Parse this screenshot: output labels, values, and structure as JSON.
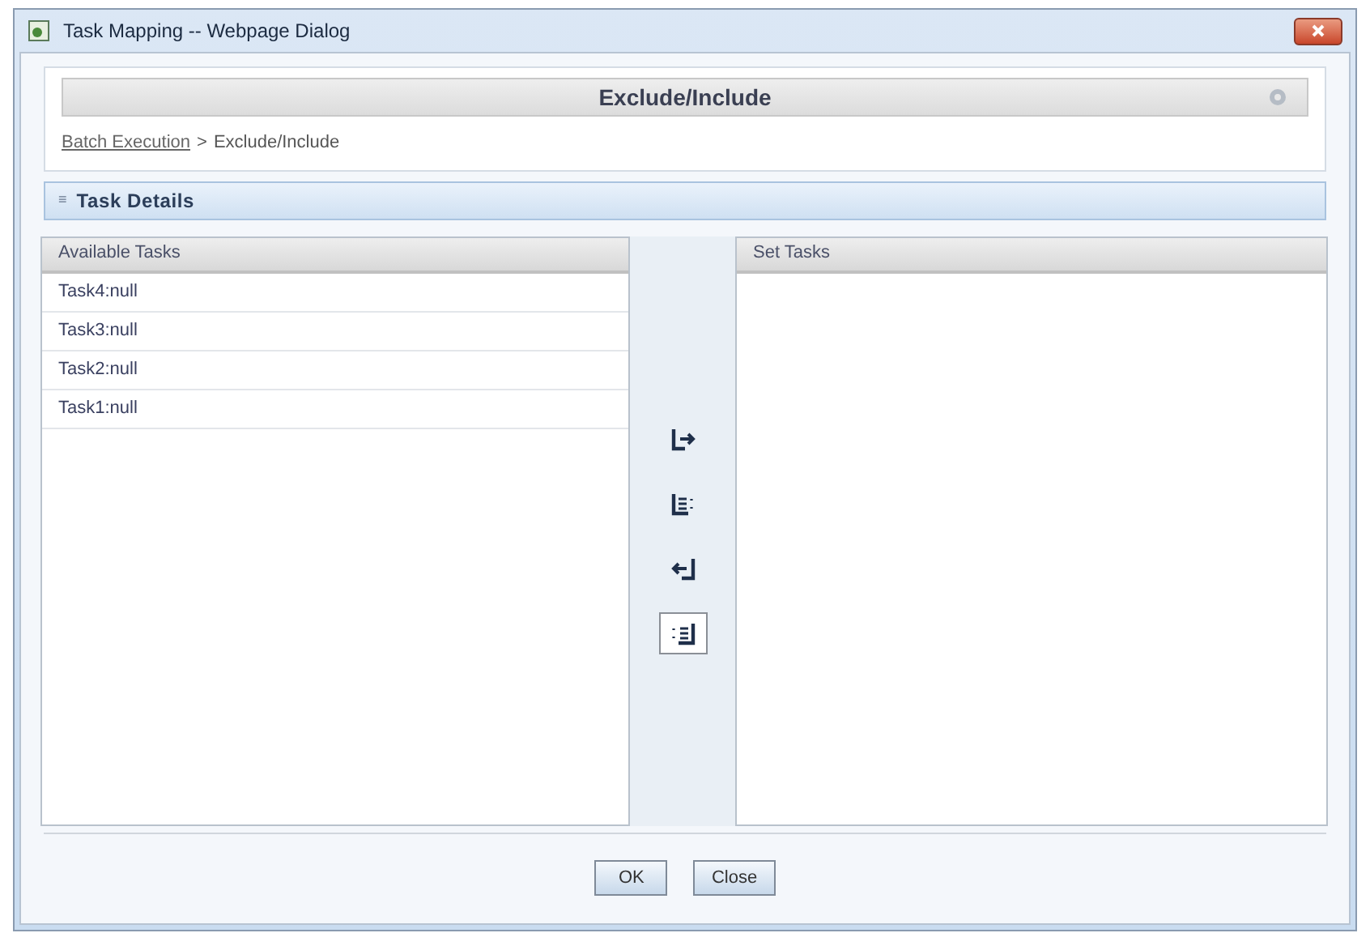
{
  "window": {
    "title": "Task Mapping -- Webpage Dialog"
  },
  "header": {
    "title": "Exclude/Include",
    "breadcrumb": {
      "link": "Batch Execution",
      "separator": ">",
      "current": "Exclude/Include"
    }
  },
  "section": {
    "title": "Task Details",
    "marker": "≡"
  },
  "available": {
    "heading": "Available Tasks",
    "items": [
      "Task4:null",
      "Task3:null",
      "Task2:null",
      "Task1:null"
    ]
  },
  "move_buttons": [
    {
      "kind": "right",
      "selected": false
    },
    {
      "kind": "all-right",
      "selected": false
    },
    {
      "kind": "left",
      "selected": false
    },
    {
      "kind": "all-left",
      "selected": true
    }
  ],
  "set": {
    "heading": "Set Tasks"
  },
  "buttons": [
    "OK",
    "Close"
  ]
}
